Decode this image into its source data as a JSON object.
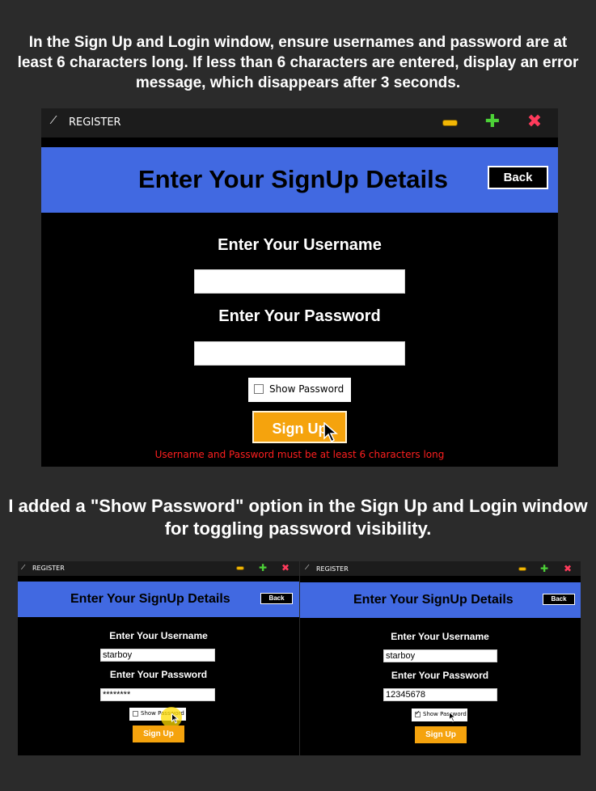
{
  "captions": {
    "top": "In the Sign Up and Login window, ensure usernames and password are at least 6 characters long. If less than 6 characters are entered, display an error message, which disappears after 3 seconds.",
    "middle": "I added a \"Show Password\" option in the Sign  Up and Login window for toggling password visibility."
  },
  "main_window": {
    "title": "REGISTER",
    "icon": "feather-icon",
    "header_title": "Enter Your SignUp Details",
    "back_label": "Back",
    "username_label": "Enter Your Username",
    "username_value": "",
    "password_label": "Enter Your Password",
    "password_value": "",
    "show_password_label": "Show Password",
    "show_password_checked": false,
    "signup_label": "Sign Up",
    "error_message": "Username and Password must be at least 6 characters long",
    "colors": {
      "header": "#4169e1",
      "button": "#f5a30d",
      "error": "#ff1f1f"
    }
  },
  "left_window": {
    "title": "REGISTER",
    "header_title": "Enter Your SignUp Details",
    "back_label": "Back",
    "username_label": "Enter Your Username",
    "username_value": "starboy",
    "password_label": "Enter Your Password",
    "password_value": "********",
    "show_password_label": "Show Password",
    "show_password_checked": false,
    "signup_label": "Sign Up"
  },
  "right_window": {
    "title": "REGISTER",
    "header_title": "Enter Your SignUp Details",
    "back_label": "Back",
    "username_label": "Enter Your Username",
    "username_value": "starboy",
    "password_label": "Enter Your Password",
    "password_value": "12345678",
    "show_password_label": "Show Password",
    "show_password_checked": true,
    "signup_label": "Sign Up"
  }
}
